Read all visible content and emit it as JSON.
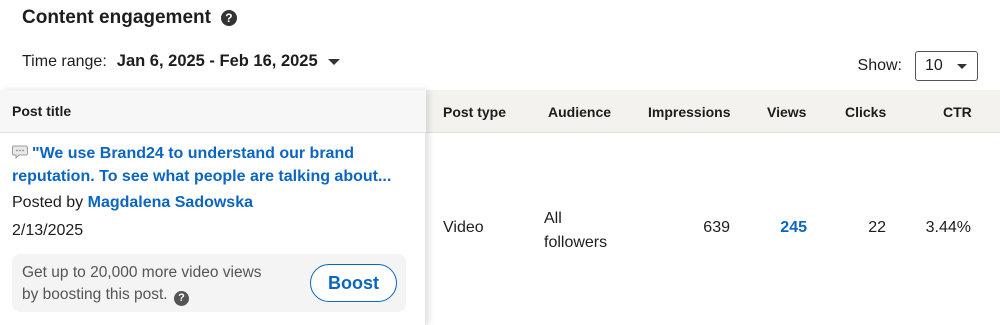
{
  "header": {
    "title": "Content engagement",
    "help_icon": "question-circle-icon"
  },
  "filters": {
    "time_range_label": "Time range:",
    "time_range_value": "Jan 6, 2025 - Feb 16, 2025",
    "show_label": "Show:",
    "show_value": "10"
  },
  "table": {
    "columns": {
      "post_title": "Post title",
      "post_type": "Post type",
      "audience": "Audience",
      "impressions": "Impressions",
      "views": "Views",
      "clicks": "Clicks",
      "ctr": "CTR"
    },
    "rows": [
      {
        "post_title_line1": "\"We use Brand24 to understand our brand",
        "post_title_line2": "reputation. To see what people are talking about...",
        "posted_by_label": "Posted by",
        "author": "Magdalena Sadowska",
        "date": "2/13/2025",
        "boost_text_line1": "Get up to 20,000 more video views",
        "boost_text_line2": "by boosting this post.",
        "boost_button": "Boost",
        "post_type": "Video",
        "audience_line1": "All",
        "audience_line2": "followers",
        "impressions": "639",
        "views": "245",
        "clicks": "22",
        "ctr": "3.44%"
      }
    ]
  },
  "colors": {
    "link": "#0a66c2",
    "header_bg": "#f4f2ee"
  }
}
